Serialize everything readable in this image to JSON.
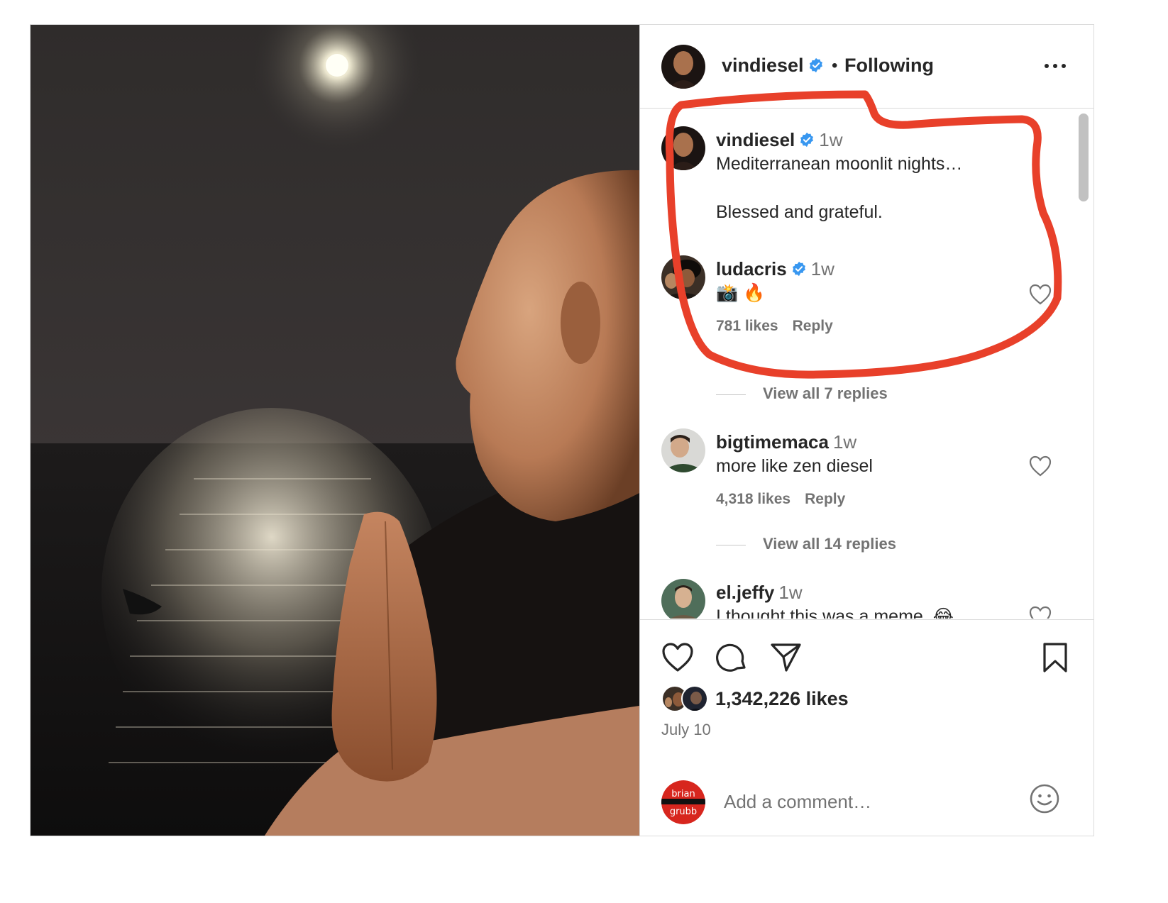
{
  "header": {
    "username": "vindiesel",
    "separator": "•",
    "follow_status": "Following"
  },
  "comments": [
    {
      "username": "vindiesel",
      "time": "1w",
      "text": "Mediterranean moonlit nights…\n\nBlessed and grateful."
    },
    {
      "username": "ludacris",
      "time": "1w",
      "text": "📸 🔥",
      "likes": "781 likes",
      "reply": "Reply",
      "view_replies": "View all 7 replies"
    },
    {
      "username": "bigtimemaca",
      "time": "1w",
      "text": "more like zen diesel",
      "likes": "4,318 likes",
      "reply": "Reply",
      "view_replies": "View all 14 replies"
    },
    {
      "username": "el.jeffy",
      "time": "1w",
      "text": "I thought this was a meme. 😂"
    }
  ],
  "actions": {
    "likes": "1,342,226 likes",
    "date": "July 10"
  },
  "add_comment": {
    "placeholder": "Add a comment…",
    "avatar_text_top": "brian",
    "avatar_text_bottom": "grubb"
  },
  "colors": {
    "verified": "#3897f0",
    "annotation": "#e8402a",
    "muted": "#737373"
  },
  "icons": [
    "verified-badge-icon",
    "more-options-icon",
    "heart-icon",
    "comment-icon",
    "share-icon",
    "bookmark-icon",
    "emoji-icon"
  ]
}
